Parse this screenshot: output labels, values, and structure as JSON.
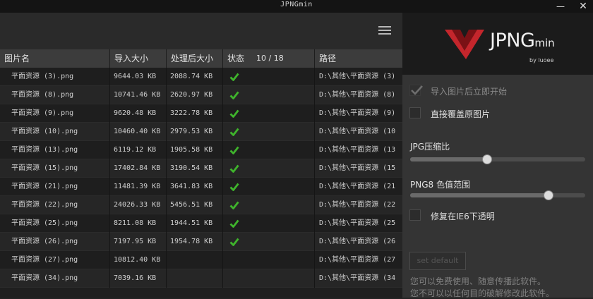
{
  "app": {
    "title": "JPNGmin",
    "minimize_glyph": "—",
    "close_glyph": "✕"
  },
  "colors": {
    "accent_red": "#c4262c",
    "check_green": "#3fb42c"
  },
  "table": {
    "headers": {
      "name": "图片名",
      "size": "导入大小",
      "after": "处理后大小",
      "status": "状态",
      "count": "10 / 18",
      "path": "路径"
    },
    "rows": [
      {
        "name": "平面资源 (3).png",
        "size": "9644.03 KB",
        "after": "2088.74 KB",
        "done": true,
        "path": "D:\\其他\\平面资源 (3)"
      },
      {
        "name": "平面资源 (8).png",
        "size": "10741.46 KB",
        "after": "2620.97 KB",
        "done": true,
        "path": "D:\\其他\\平面资源 (8)"
      },
      {
        "name": "平面资源 (9).png",
        "size": "9620.48 KB",
        "after": "3222.78 KB",
        "done": true,
        "path": "D:\\其他\\平面资源 (9)"
      },
      {
        "name": "平面资源 (10).png",
        "size": "10460.40 KB",
        "after": "2979.53 KB",
        "done": true,
        "path": "D:\\其他\\平面资源 (10"
      },
      {
        "name": "平面资源 (13).png",
        "size": "6119.12 KB",
        "after": "1905.58 KB",
        "done": true,
        "path": "D:\\其他\\平面资源 (13"
      },
      {
        "name": "平面资源 (15).png",
        "size": "17402.84 KB",
        "after": "3190.54 KB",
        "done": true,
        "path": "D:\\其他\\平面资源 (15"
      },
      {
        "name": "平面资源 (21).png",
        "size": "11481.39 KB",
        "after": "3641.83 KB",
        "done": true,
        "path": "D:\\其他\\平面资源 (21"
      },
      {
        "name": "平面资源 (22).png",
        "size": "24026.33 KB",
        "after": "5456.51 KB",
        "done": true,
        "path": "D:\\其他\\平面资源 (22"
      },
      {
        "name": "平面资源 (25).png",
        "size": "8211.08 KB",
        "after": "1944.51 KB",
        "done": true,
        "path": "D:\\其他\\平面资源 (25"
      },
      {
        "name": "平面资源 (26).png",
        "size": "7197.95 KB",
        "after": "1954.78 KB",
        "done": true,
        "path": "D:\\其他\\平面资源 (26"
      },
      {
        "name": "平面资源 (27).png",
        "size": "10812.40 KB",
        "after": "",
        "done": false,
        "path": "D:\\其他\\平面资源 (27"
      },
      {
        "name": "平面资源 (34).png",
        "size": "7039.16 KB",
        "after": "",
        "done": false,
        "path": "D:\\其他\\平面资源 (34"
      }
    ]
  },
  "panel": {
    "logo": {
      "main": "JPNG",
      "small": "min",
      "by": "by luoee"
    },
    "options": {
      "auto_start": {
        "label": "导入图片后立即开始",
        "checked": true,
        "enabled": false
      },
      "overwrite": {
        "label": "直接覆盖原图片",
        "checked": false,
        "enabled": true
      },
      "ie6": {
        "label": "修复在IE6下透明",
        "checked": false,
        "enabled": true
      }
    },
    "jpg_slider": {
      "label": "JPG压缩比",
      "value": 0.44
    },
    "png_slider": {
      "label": "PNG8 色值范围",
      "value": 0.79
    },
    "reset_label": "set default",
    "notes": [
      "您可以免费使用、随意传播此软件。",
      "您不可以以任何目的破解修改此软件。"
    ]
  }
}
